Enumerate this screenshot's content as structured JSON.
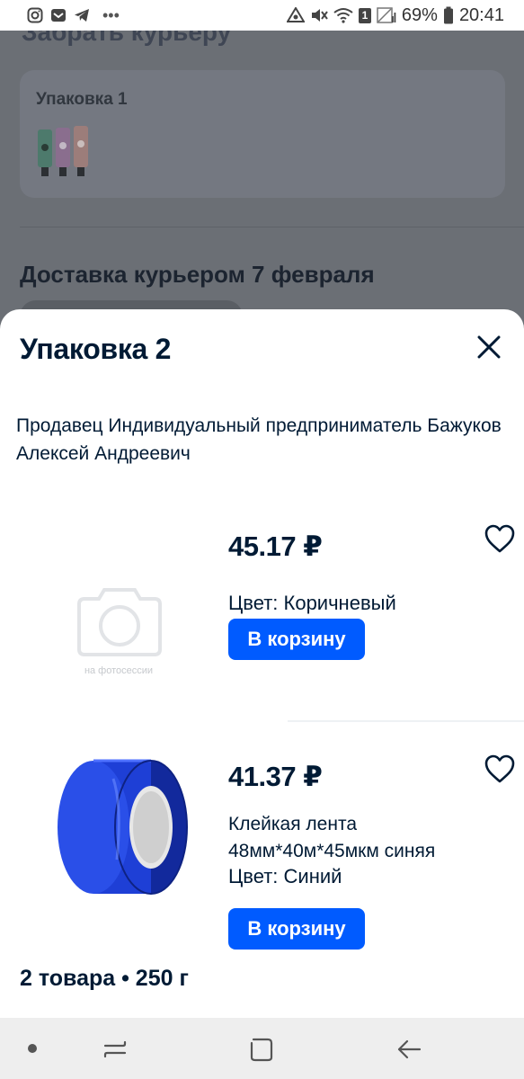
{
  "status_bar": {
    "battery": "69%",
    "time": "20:41",
    "sim_slot": "1",
    "left_icons": [
      "instagram-icon",
      "mail-icon",
      "telegram-icon"
    ],
    "more": "•••"
  },
  "background": {
    "top_fragment": "Забрать курьеру",
    "package_card_title": "Упаковка 1",
    "delivery_heading": "Доставка курьером 7 февраля"
  },
  "sheet": {
    "title": "Упаковка 2",
    "seller_label": "Продавец",
    "seller_name": "Индивидуальный предприниматель Бажуков Алексей Андреевич",
    "products": [
      {
        "price": "45.17 ₽",
        "photo_placeholder_caption": "на фотосессии",
        "color_label": "Цвет: Коричневый",
        "cart_button": "В корзину"
      },
      {
        "price": "41.37 ₽",
        "name": "Клейкая лента 48мм*40м*45мкм синяя",
        "color_label": "Цвет: Синий",
        "cart_button": "В корзину"
      }
    ],
    "summary": "2 товара • 250 г"
  },
  "colors": {
    "accent": "#005bff",
    "text": "#001a34",
    "tape": "#1e3fd6"
  }
}
